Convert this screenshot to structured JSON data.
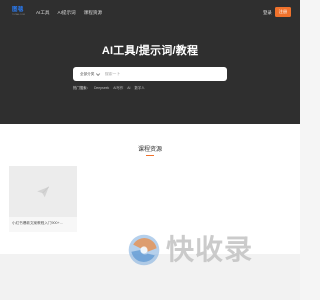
{
  "header": {
    "logo_main": "图毯",
    "logo_sub": "TUTAN.COM",
    "nav": [
      "AI工具",
      "AI提示词",
      "课程资源"
    ],
    "login_label": "登录",
    "register_label": "注册"
  },
  "hero": {
    "title": "AI工具/提示词/教程",
    "search": {
      "category": "全部分类",
      "placeholder": "搜索一下"
    },
    "hot": {
      "label": "热门搜索：",
      "tags": [
        "Deepseek",
        "AI写作",
        "AI",
        "数字人"
      ]
    }
  },
  "courses": {
    "title": "课程资源",
    "cards": [
      {
        "title": "小红书爆款文案教程入门900+..."
      }
    ]
  },
  "watermark": {
    "text": "快收录"
  },
  "colors": {
    "accent": "#f0722c",
    "hero_bg": "#2f2f2f",
    "logo": "#2a7cf6"
  }
}
